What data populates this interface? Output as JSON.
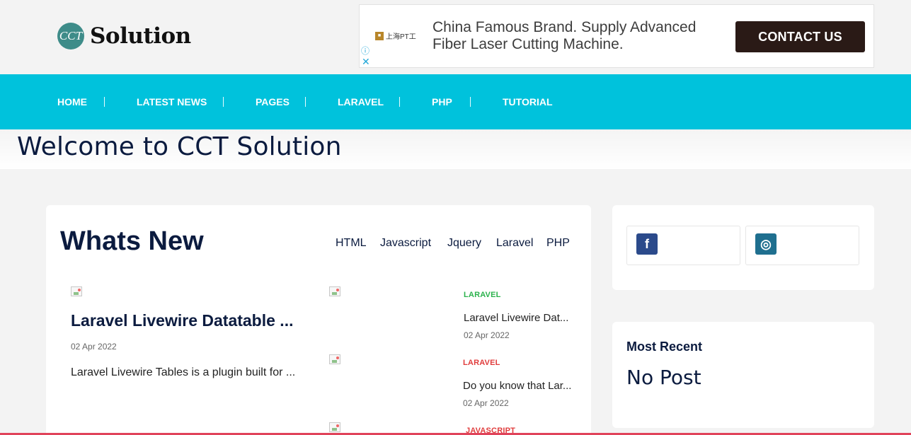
{
  "logo": {
    "badge": "CCT",
    "text": "Solution"
  },
  "ad": {
    "brand": "上海PT工",
    "text_line1": "China Famous Brand. Supply Advanced",
    "text_line2": "Fiber Laser Cutting Machine.",
    "cta": "CONTACT US",
    "info_icon": "ⓘ",
    "close_icon": "✕"
  },
  "nav": {
    "items": [
      {
        "label": "HOME"
      },
      {
        "label": "LATEST NEWS"
      },
      {
        "label": "PAGES"
      },
      {
        "label": "LARAVEL"
      },
      {
        "label": "PHP"
      },
      {
        "label": "TUTORIAL"
      }
    ]
  },
  "hero": {
    "title": "Welcome to CCT Solution"
  },
  "whats_new": {
    "heading": "Whats New",
    "tabs": [
      "HTML",
      "Javascript",
      "Jquery",
      "Laravel",
      "PHP"
    ],
    "featured": {
      "title": "Laravel Livewire Datatable ...",
      "date": "02 Apr 2022",
      "excerpt": "Laravel Livewire Tables is a plugin built for ..."
    },
    "side_posts": [
      {
        "category": "LARAVEL",
        "category_color": "#2bb24c",
        "title": "Laravel Livewire Dat...",
        "date": "02 Apr 2022"
      },
      {
        "category": "LARAVEL",
        "category_color": "#e03c3c",
        "title": "Do you know that Lar...",
        "date": "02 Apr 2022"
      },
      {
        "category": "JAVASCRIPT",
        "category_color": "#e03c3c"
      }
    ]
  },
  "social": [
    {
      "icon": "facebook-icon",
      "glyph": "f",
      "color": "#2b4a8b"
    },
    {
      "icon": "instagram-icon",
      "glyph": "◎",
      "color": "#1f6f8f"
    }
  ],
  "most_recent": {
    "title": "Most Recent",
    "empty_text": "No Post"
  },
  "colors": {
    "nav_bg": "#00c2dc",
    "heading": "#0b1b3f",
    "cta_bg": "#2a1a16"
  }
}
